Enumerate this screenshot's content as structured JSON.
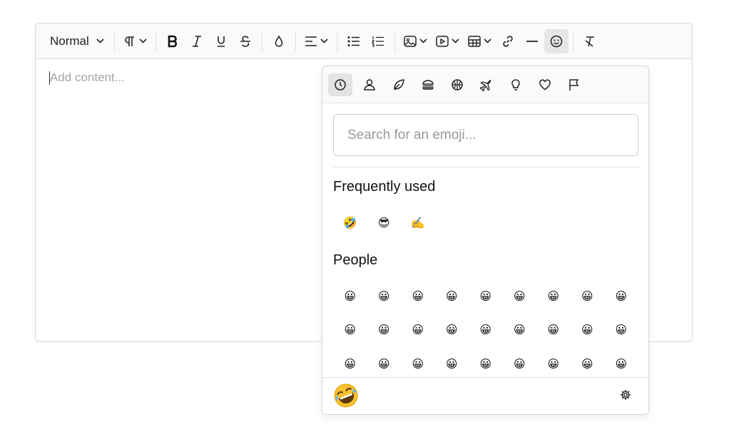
{
  "toolbar": {
    "style_select": "Normal",
    "icons": [
      "chevron-down-icon",
      "paragraph-icon",
      "bold-icon",
      "italic-icon",
      "underline-icon",
      "strikethrough-icon",
      "color-drop-icon",
      "align-icon",
      "bullet-list-icon",
      "numbered-list-icon",
      "image-icon",
      "video-icon",
      "table-icon",
      "link-icon",
      "horizontal-rule-icon",
      "emoji-icon",
      "clear-format-icon"
    ]
  },
  "editor": {
    "placeholder": "Add content..."
  },
  "emoji_picker": {
    "categories": [
      "recent-icon",
      "people-icon",
      "nature-leaf-icon",
      "food-burger-icon",
      "activity-ball-icon",
      "travel-plane-icon",
      "objects-bulb-icon",
      "symbols-heart-icon",
      "flags-icon"
    ],
    "active_category": "recent-icon",
    "search_placeholder": "Search for an emoji...",
    "sections": [
      {
        "title": "Frequently used",
        "rows": [
          [
            "🤣",
            "😎",
            "✍️"
          ]
        ]
      },
      {
        "title": "People",
        "rows": [
          [
            "😀",
            "😀",
            "😀",
            "😀",
            "😀",
            "😀",
            "😀",
            "😀",
            "😀"
          ],
          [
            "😀",
            "😀",
            "😀",
            "😀",
            "😀",
            "😀",
            "😀",
            "😀",
            "😀"
          ],
          [
            "😀",
            "😀",
            "😀",
            "😀",
            "😀",
            "😀",
            "😀",
            "😀",
            "😀"
          ]
        ]
      }
    ],
    "preview_emoji": "🤣",
    "footer_icon": "gear-icon"
  }
}
